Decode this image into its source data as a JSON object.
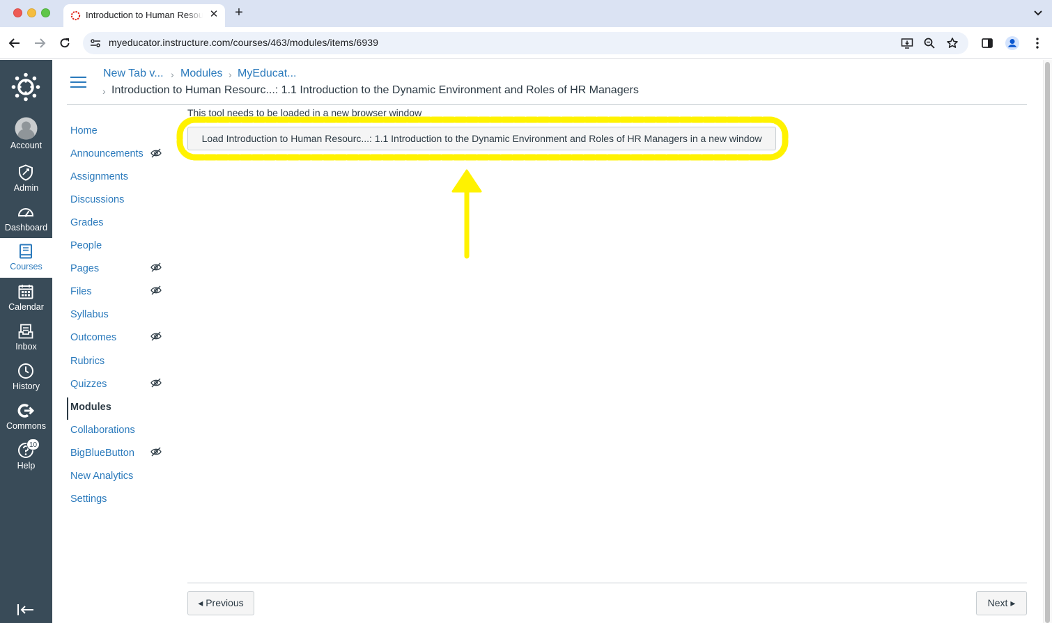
{
  "browser": {
    "tab_title": "Introduction to Human Resour",
    "url": "myeducator.instructure.com/courses/463/modules/items/6939",
    "icons": [
      "back-icon",
      "forward-icon",
      "reload-icon",
      "site-settings-icon",
      "install-app-icon",
      "zoom-icon",
      "bookmark-star-icon",
      "side-panel-icon",
      "profile-icon",
      "menu-icon"
    ]
  },
  "global_nav": {
    "items": [
      {
        "label": "Account",
        "icon": "avatar-icon"
      },
      {
        "label": "Admin",
        "icon": "shield-icon"
      },
      {
        "label": "Dashboard",
        "icon": "dashboard-icon"
      },
      {
        "label": "Courses",
        "icon": "book-icon",
        "active": true
      },
      {
        "label": "Calendar",
        "icon": "calendar-icon"
      },
      {
        "label": "Inbox",
        "icon": "inbox-icon"
      },
      {
        "label": "History",
        "icon": "clock-icon"
      },
      {
        "label": "Commons",
        "icon": "commons-icon"
      },
      {
        "label": "Help",
        "icon": "help-icon",
        "badge": "10"
      }
    ]
  },
  "breadcrumb": {
    "items": [
      "New Tab v...",
      "Modules",
      "MyEducat..."
    ],
    "current": "Introduction to Human Resourc...: 1.1 Introduction to the Dynamic Environment and Roles of HR Managers"
  },
  "course_nav": {
    "items": [
      {
        "label": "Home"
      },
      {
        "label": "Announcements",
        "hidden": true
      },
      {
        "label": "Assignments"
      },
      {
        "label": "Discussions"
      },
      {
        "label": "Grades"
      },
      {
        "label": "People"
      },
      {
        "label": "Pages",
        "hidden": true
      },
      {
        "label": "Files",
        "hidden": true
      },
      {
        "label": "Syllabus"
      },
      {
        "label": "Outcomes",
        "hidden": true
      },
      {
        "label": "Rubrics"
      },
      {
        "label": "Quizzes",
        "hidden": true
      },
      {
        "label": "Modules",
        "active": true
      },
      {
        "label": "Collaborations"
      },
      {
        "label": "BigBlueButton",
        "hidden": true
      },
      {
        "label": "New Analytics"
      },
      {
        "label": "Settings"
      }
    ]
  },
  "main": {
    "notice": "This tool needs to be loaded in a new browser window",
    "load_button": "Load Introduction to Human Resourc...: 1.1 Introduction to the Dynamic Environment and Roles of HR Managers in a new window",
    "annotation_color": "#fff200"
  },
  "footer": {
    "previous": "◂ Previous",
    "next": "Next ▸"
  },
  "colors": {
    "nav_bg": "#394b58",
    "link": "#2b7abc",
    "text": "#2d3b45"
  }
}
